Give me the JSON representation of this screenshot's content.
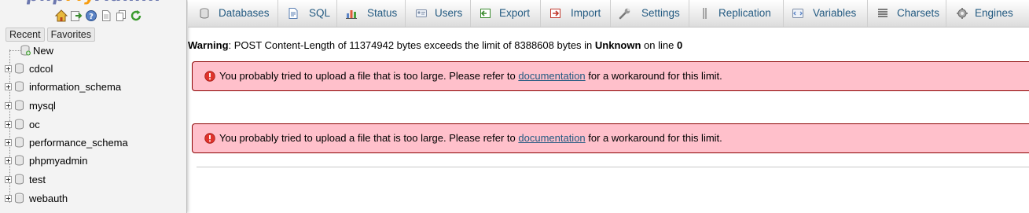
{
  "nav": {
    "tabs": [
      {
        "label": "Recent"
      },
      {
        "label": "Favorites"
      }
    ],
    "new_label": "New",
    "databases": [
      {
        "name": "cdcol"
      },
      {
        "name": "information_schema"
      },
      {
        "name": "mysql"
      },
      {
        "name": "oc"
      },
      {
        "name": "performance_schema"
      },
      {
        "name": "phpmyadmin"
      },
      {
        "name": "test"
      },
      {
        "name": "webauth"
      }
    ]
  },
  "menu": {
    "items": [
      {
        "label": "Databases",
        "icon": "database-icon"
      },
      {
        "label": "SQL",
        "icon": "sql-icon"
      },
      {
        "label": "Status",
        "icon": "status-chart-icon"
      },
      {
        "label": "Users",
        "icon": "users-icon"
      },
      {
        "label": "Export",
        "icon": "export-icon"
      },
      {
        "label": "Import",
        "icon": "import-icon"
      },
      {
        "label": "Settings",
        "icon": "wrench-icon"
      },
      {
        "label": "Replication",
        "icon": "replication-icon"
      },
      {
        "label": "Variables",
        "icon": "variables-icon"
      },
      {
        "label": "Charsets",
        "icon": "charsets-icon"
      },
      {
        "label": "Engines",
        "icon": "engines-icon"
      }
    ]
  },
  "warning": {
    "prefix": "Warning",
    "text_1": ": POST Content-Length of 11374942 bytes exceeds the limit of 8388608 bytes in ",
    "location": "Unknown",
    "text_2": " on line ",
    "line": "0"
  },
  "errors": [
    {
      "text_before": "You probably tried to upload a file that is too large. Please refer to ",
      "link_text": "documentation",
      "text_after": " for a workaround for this limit."
    },
    {
      "text_before": "You probably tried to upload a file that is too large. Please refer to ",
      "link_text": "documentation",
      "text_after": " for a workaround for this limit."
    }
  ],
  "colors": {
    "link": "#235a81",
    "error_background": "#ffc0cb",
    "error_border": "#8b0000",
    "brand_blue": "#6c78af",
    "brand_orange": "#f89c0e"
  }
}
